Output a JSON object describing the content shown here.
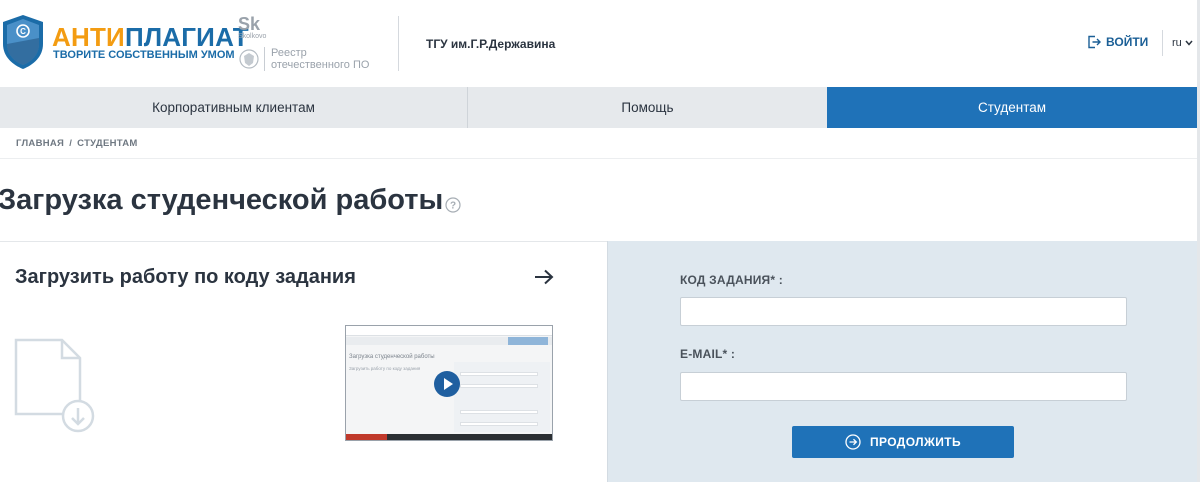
{
  "header": {
    "brand_part1": "АНТИ",
    "brand_part2": "ПЛАГИАТ",
    "slogan": "ТВОРИТЕ СОБСТВЕННЫМ УМОМ",
    "skolkovo": "Skolkovo",
    "registry_line1": "Реестр",
    "registry_line2": "отечественного ПО",
    "university": "ТГУ им.Г.Р.Державина",
    "login_label": "ВОЙТИ",
    "language": "ru"
  },
  "nav": {
    "items": [
      {
        "label": "Корпоративным клиентам"
      },
      {
        "label": "Помощь"
      },
      {
        "label": "Студентам"
      }
    ]
  },
  "breadcrumb": {
    "home": "ГЛАВНАЯ",
    "separator": "/",
    "current": "СТУДЕНТАМ"
  },
  "page": {
    "title": "Загрузка студенческой работы"
  },
  "left_panel": {
    "title": "Загрузить работу по коду задания",
    "video_title": "Загрузка студенческой работы",
    "video_subtitle": "Загрузить работу по коду задания"
  },
  "form": {
    "code_label": "КОД ЗАДАНИЯ* :",
    "code_value": "",
    "email_label": "E-MAIL* :",
    "email_value": "",
    "submit_label": "ПРОДОЛЖИТЬ"
  },
  "colors": {
    "brand_orange": "#f39c12",
    "brand_blue": "#1b6ca8",
    "active_nav": "#1f72b8",
    "form_bg": "#dfe8ef"
  }
}
